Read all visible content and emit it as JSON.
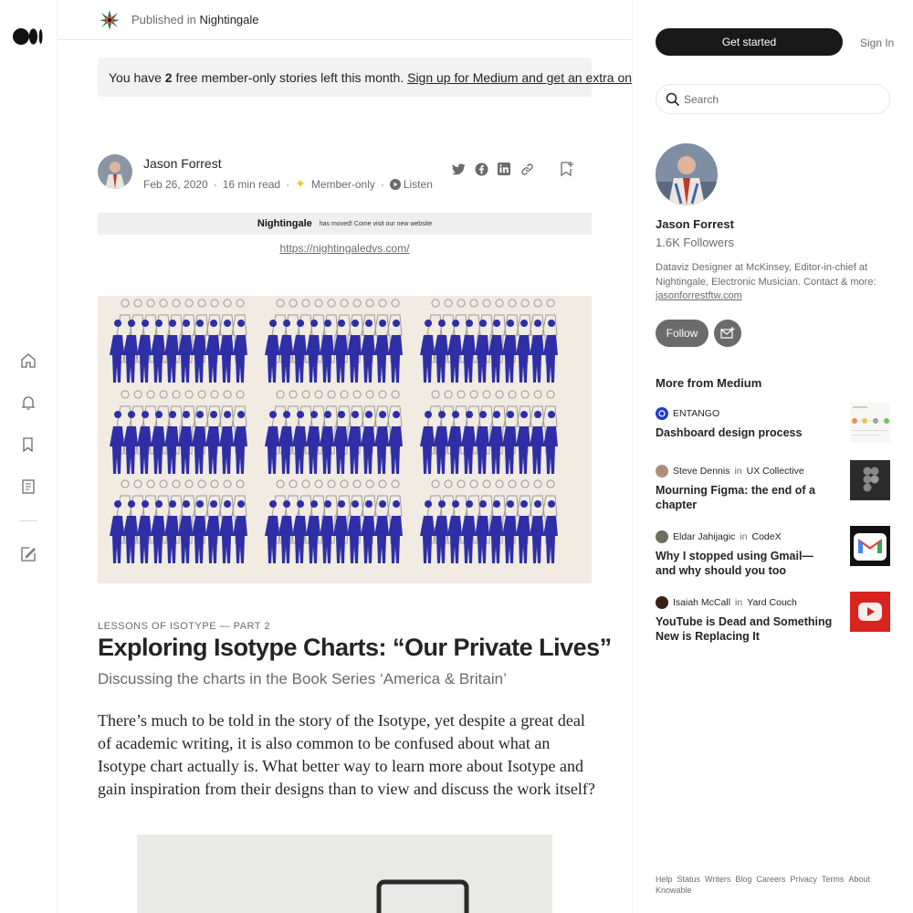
{
  "publication": {
    "prefix": "Published in",
    "name": "Nightingale"
  },
  "banner": {
    "text_before": "You have ",
    "count": "2",
    "text_after": " free member-only stories left this month. ",
    "link": "Sign up for Medium and get an extra one"
  },
  "author": {
    "name": "Jason Forrest",
    "date": "Feb 26, 2020",
    "read_time": "16 min read",
    "membership": "Member-only",
    "listen": "Listen",
    "share_icons": [
      "twitter-icon",
      "facebook-icon",
      "linkedin-icon",
      "link-icon"
    ]
  },
  "nightingale_notice": {
    "name": "Nightingale",
    "message": "has moved! Come visit our new website",
    "link": "https://nightingaledvs.com/"
  },
  "article": {
    "kicker": "LESSONS OF ISOTYPE — PART 2",
    "title": "Exploring Isotype Charts: “Our Private Lives”",
    "subtitle": "Discussing the charts in the Book Series ‘America & Britain’",
    "body": "There’s much to be told in the story of the Isotype, yet despite a great deal of academic writing, it is also common to be confused about what an Isotype chart actually is. What better way to learn more about Isotype and gain inspiration from their designs than to view and discuss the work itself?"
  },
  "sidebar": {
    "get_started": "Get started",
    "sign_in": "Sign In",
    "search_placeholder": "Search",
    "author_name": "Jason Forrest",
    "followers": "1.6K Followers",
    "bio": "Dataviz Designer at McKinsey, Editor-in-chief at Nightingale, Electronic Musician. Contact & more: ",
    "bio_link": "jasonforrestftw.com",
    "follow": "Follow",
    "more_heading": "More from Medium",
    "stories": [
      {
        "author": "ENTANGO",
        "in": "",
        "publication": "",
        "title": "Dashboard design process",
        "avatar_color": "#1e3ccf",
        "thumb": "dashboard-thumbnail"
      },
      {
        "author": "Steve Dennis",
        "in": "in",
        "publication": "UX Collective",
        "title": "Mourning Figma: the end of a chapter",
        "avatar_color": "#b08f7a",
        "thumb": "figma-thumbnail"
      },
      {
        "author": "Eldar Jahijagic",
        "in": "in",
        "publication": "CodeX",
        "title": "Why I stopped using Gmail—and why should you too",
        "avatar_color": "#6b6f5f",
        "thumb": "gmail-thumbnail"
      },
      {
        "author": "Isaiah McCall",
        "in": "in",
        "publication": "Yard Couch",
        "title": "YouTube is Dead and Something New is Replacing It",
        "avatar_color": "#3a2218",
        "thumb": "youtube-thumbnail"
      }
    ],
    "footer_links": [
      "Help",
      "Status",
      "Writers",
      "Blog",
      "Careers",
      "Privacy",
      "Terms",
      "About",
      "Knowable"
    ]
  },
  "colors": {
    "accent_star": "#ffc017",
    "isotype_blue": "#2e2fa6",
    "dark_button": "#191919"
  }
}
